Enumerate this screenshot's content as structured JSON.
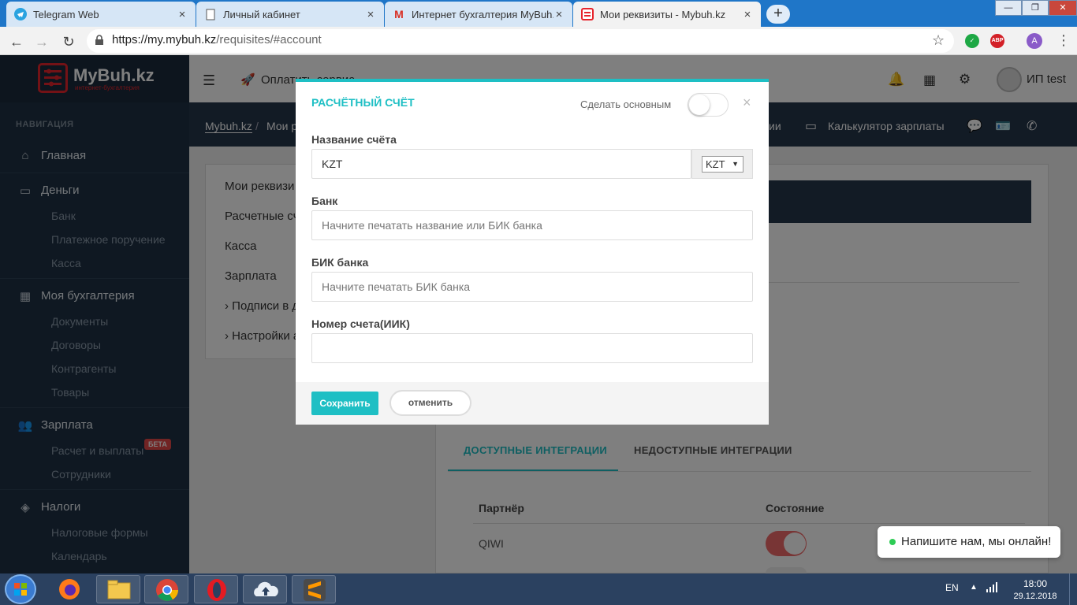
{
  "browser": {
    "tabs": [
      {
        "title": "Telegram Web",
        "active": false
      },
      {
        "title": "Личный кабинет",
        "active": false
      },
      {
        "title": "Интернет бухгалтерия MyBuh.kz",
        "active": false
      },
      {
        "title": "Мои реквизиты - Mybuh.kz",
        "active": true
      }
    ],
    "new_tab": "+",
    "url_host": "https://my.mybuh.kz",
    "url_path": "/requisites/#account",
    "profile_initial": "A",
    "abp_label": "ABP",
    "window_controls": [
      "—",
      "❐",
      "✕"
    ]
  },
  "app": {
    "logo_text": "MyBuh.kz",
    "logo_sub": "интернет-бухгалтерия",
    "nav_heading": "НАВИГАЦИЯ",
    "nav": {
      "home": "Главная",
      "money": "Деньги",
      "bank": "Банк",
      "payment_order": "Платежное поручение",
      "cash": "Касса",
      "my_accounting": "Моя бухгалтерия",
      "documents": "Документы",
      "contracts": "Договоры",
      "counterparties": "Контрагенты",
      "goods": "Товары",
      "salary": "Зарплата",
      "salary_calc": "Расчет и выплаты",
      "beta_badge": "БЕТА",
      "employees": "Сотрудники",
      "taxes": "Налоги",
      "tax_forms": "Налоговые формы",
      "calendar": "Календарь"
    },
    "topbar": {
      "pay_service": "Оплатить сервис",
      "user": "ИП test"
    },
    "breadcrumb": {
      "root": "Mybuh.kz",
      "separator": "/",
      "current": "Мои р",
      "partial_link": "ии",
      "salary_calculator": "Калькулятор зарплаты"
    },
    "left_menu": {
      "requisites": "Мои реквизи",
      "accounts": "Расчетные сч",
      "cash": "Касса",
      "salary": "Зарплата",
      "signatures": "Подписи в д",
      "settings": "Настройки а"
    },
    "integrations": {
      "tab_available": "ДОСТУПНЫЕ ИНТЕГРАЦИИ",
      "tab_unavailable": "НЕДОСТУПНЫЕ ИНТЕГРАЦИИ",
      "col_partner": "Партнёр",
      "col_status": "Состояние",
      "row1_partner": "QIWI",
      "row1_enabled": true
    }
  },
  "modal": {
    "title": "РАСЧЁТНЫЙ СЧЁТ",
    "make_primary": "Сделать основным",
    "make_primary_on": false,
    "close": "×",
    "account_name_label": "Название счёта",
    "account_name_value": "KZT",
    "currency_selected": "KZT",
    "bank_label": "Банк",
    "bank_placeholder": "Начните печатать название или БИК банка",
    "bik_label": "БИК банка",
    "bik_placeholder": "Начните печатать БИК банка",
    "iik_label": "Номер счета(ИИК)",
    "iik_value": "",
    "save": "Сохранить",
    "cancel": "отменить"
  },
  "chat": {
    "text": "Напишите нам, мы онлайн!"
  },
  "taskbar": {
    "lang": "EN",
    "time": "18:00",
    "date": "29.12.2018"
  },
  "colors": {
    "accent": "#1ebfc4",
    "sidebar": "#1f3144",
    "brand_red": "#e7242c",
    "beta": "#e24848"
  }
}
